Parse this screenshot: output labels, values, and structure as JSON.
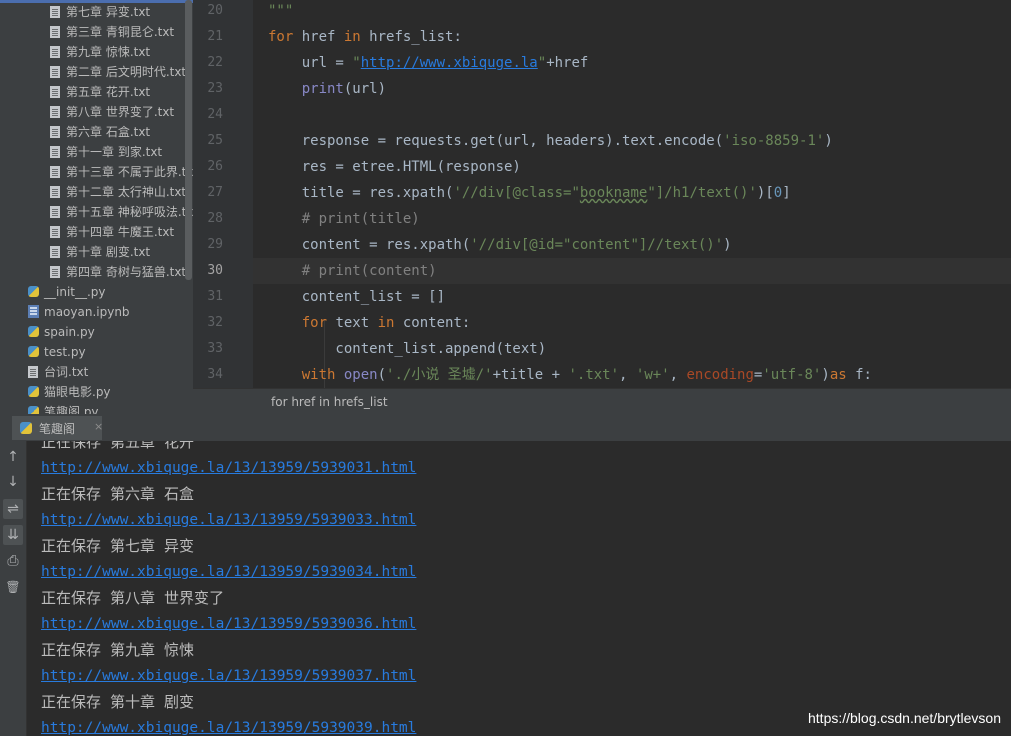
{
  "project_tree": {
    "files": [
      {
        "name": "第七章 异变.txt",
        "icon": "text-file-icon"
      },
      {
        "name": "第三章 青铜昆仑.txt",
        "icon": "text-file-icon"
      },
      {
        "name": "第九章 惊悚.txt",
        "icon": "text-file-icon"
      },
      {
        "name": "第二章 后文明时代.txt",
        "icon": "text-file-icon"
      },
      {
        "name": "第五章 花开.txt",
        "icon": "text-file-icon"
      },
      {
        "name": "第八章 世界变了.txt",
        "icon": "text-file-icon"
      },
      {
        "name": "第六章 石盒.txt",
        "icon": "text-file-icon"
      },
      {
        "name": "第十一章 到家.txt",
        "icon": "text-file-icon"
      },
      {
        "name": "第十三章 不属于此界.txt",
        "icon": "text-file-icon"
      },
      {
        "name": "第十二章 太行神山.txt",
        "icon": "text-file-icon"
      },
      {
        "name": "第十五章 神秘呼吸法.txt",
        "icon": "text-file-icon"
      },
      {
        "name": "第十四章 牛魔王.txt",
        "icon": "text-file-icon"
      },
      {
        "name": "第十章 剧变.txt",
        "icon": "text-file-icon"
      },
      {
        "name": "第四章 奇树与猛兽.txt",
        "icon": "text-file-icon"
      },
      {
        "name": "__init__.py",
        "icon": "python-file-icon"
      },
      {
        "name": "maoyan.ipynb",
        "icon": "notebook-file-icon"
      },
      {
        "name": "spain.py",
        "icon": "python-file-icon"
      },
      {
        "name": "test.py",
        "icon": "python-file-icon"
      },
      {
        "name": "台词.txt",
        "icon": "text-file-icon"
      },
      {
        "name": "猫眼电影.py",
        "icon": "python-file-icon"
      },
      {
        "name": "笔趣阁.py",
        "icon": "python-file-icon"
      }
    ]
  },
  "editor": {
    "line_numbers": [
      "20",
      "21",
      "22",
      "23",
      "24",
      "25",
      "26",
      "27",
      "28",
      "29",
      "30",
      "31",
      "32",
      "33",
      "34"
    ],
    "current_line": "30"
  },
  "breadcrumb": "for href in hrefs_list",
  "run": {
    "tab_label": "笔趣阁",
    "close": "×",
    "tool_icons": [
      "↑",
      "↓",
      "⇌",
      "⇊",
      "⎙",
      "🗑"
    ],
    "output": [
      {
        "text": "正在保存 第五章 花开",
        "type": "text"
      },
      {
        "text": "http://www.xbiquge.la/13/13959/5939031.html",
        "type": "link"
      },
      {
        "text": "正在保存 第六章 石盒",
        "type": "text"
      },
      {
        "text": "http://www.xbiquge.la/13/13959/5939033.html",
        "type": "link"
      },
      {
        "text": "正在保存 第七章 异变",
        "type": "text"
      },
      {
        "text": "http://www.xbiquge.la/13/13959/5939034.html",
        "type": "link"
      },
      {
        "text": "正在保存 第八章 世界变了",
        "type": "text"
      },
      {
        "text": "http://www.xbiquge.la/13/13959/5939036.html",
        "type": "link"
      },
      {
        "text": "正在保存 第九章 惊悚",
        "type": "text"
      },
      {
        "text": "http://www.xbiquge.la/13/13959/5939037.html",
        "type": "link"
      },
      {
        "text": "正在保存 第十章 剧变",
        "type": "text"
      },
      {
        "text": "http://www.xbiquge.la/13/13959/5939039.html",
        "type": "link"
      }
    ]
  },
  "watermark": "https://blog.csdn.net/brytlevson",
  "colors": {
    "keyword": "#cc7832",
    "string": "#6a8759",
    "comment": "#808080",
    "builtin": "#8888c6",
    "param": "#aa4926",
    "link": "#287bde"
  }
}
